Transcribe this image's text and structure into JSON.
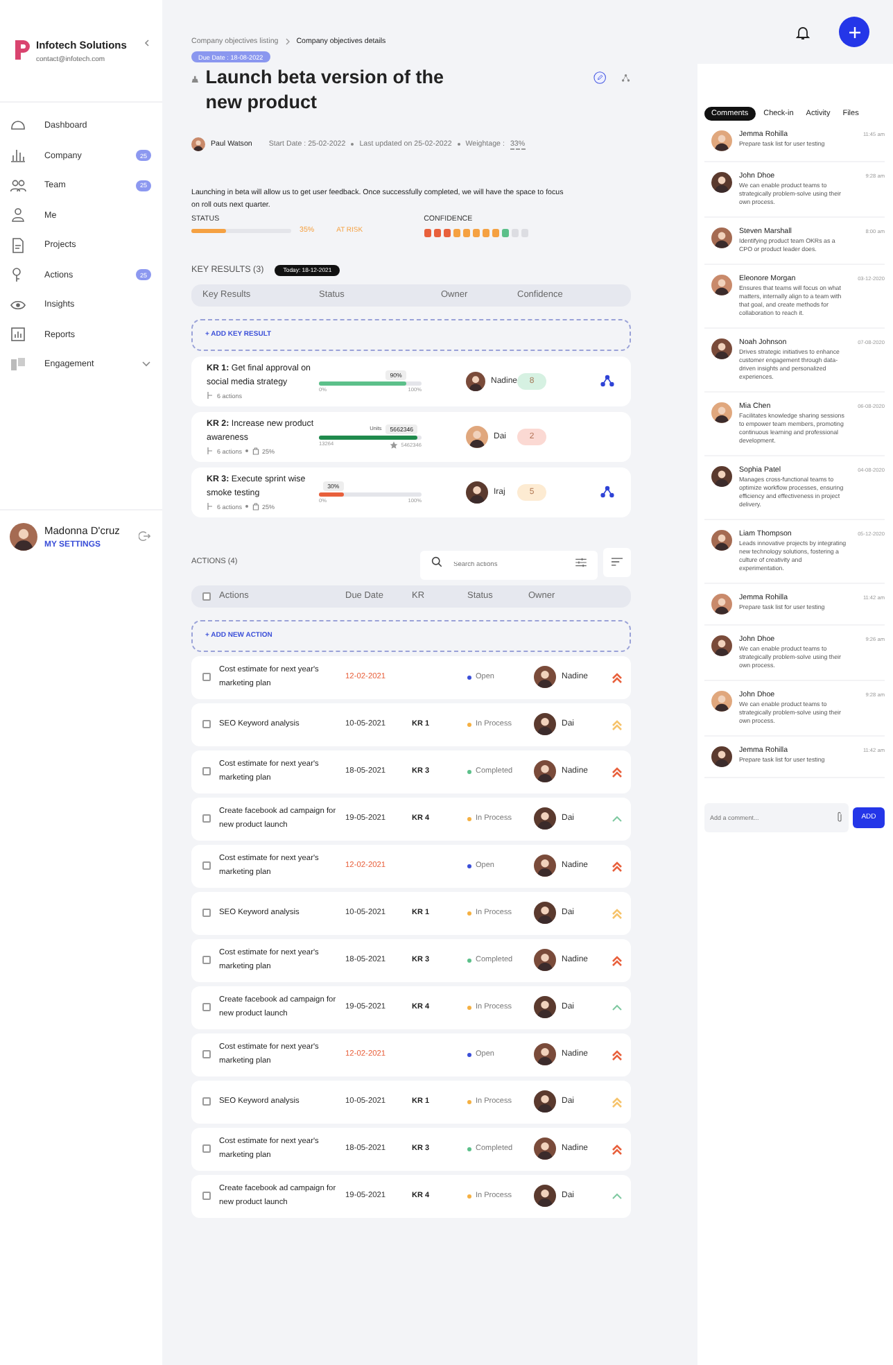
{
  "sidebar": {
    "company": "Infotech Solutions",
    "email": "contact@infotech.com",
    "items": [
      {
        "label": "Dashboard",
        "kind": "link"
      },
      {
        "label": "Company",
        "kind": "link",
        "badge": "25"
      },
      {
        "label": "Team",
        "kind": "link",
        "badge": "25"
      },
      {
        "label": "Me",
        "kind": "link"
      },
      {
        "label": "Projects",
        "kind": "link"
      },
      {
        "label": "Actions",
        "kind": "link",
        "badge": "25"
      },
      {
        "label": "Insights",
        "kind": "link"
      },
      {
        "label": "Reports",
        "kind": "link"
      },
      {
        "label": "Engagement",
        "kind": "group"
      }
    ],
    "user": {
      "name": "Madonna D'cruz",
      "link": "MY SETTINGS"
    }
  },
  "objective": {
    "breadcrumb": [
      "Company objectives listing",
      "Company objectives details"
    ],
    "due": "Due Date : 18-08-2022",
    "title": "Launch beta version of the new product",
    "owner": "Paul Watson",
    "start": "Start Date : 25-02-2022",
    "updated": "Last updated on 25-02-2022",
    "weightage_label": "Weightage :",
    "weightage": "33%",
    "description": "Launching in beta will allow us to get user feedback. Once successfully completed, we will have the space to focus on roll outs next quarter.",
    "status_label": "STATUS",
    "level": 0.35,
    "percent": "35%",
    "risk": "AT RISK",
    "confidence_label": "CONFIDENCE",
    "confidence": [
      {
        "color": "#e8603c"
      },
      {
        "color": "#e8603c"
      },
      {
        "color": "#e8603c"
      },
      {
        "color": "#f5a142"
      },
      {
        "color": "#f5a142"
      },
      {
        "color": "#f5a142"
      },
      {
        "color": "#f5a142"
      },
      {
        "color": "#f5a142"
      },
      {
        "color": "#5cc08a"
      },
      {
        "color": "#dcdde2"
      },
      {
        "color": "#dcdde2"
      }
    ]
  },
  "key_results": {
    "heading": "KEY RESULTS (3)",
    "today": "Today: 18-12-2021",
    "columns": [
      "Key Results",
      "Status",
      "Owner",
      "Confidence"
    ],
    "add": "+ ADD KEY RESULT",
    "items": [
      {
        "title": "**KR 1:** Get final approval on social media strategy",
        "actions": "6 actions",
        "progress": {
          "level": 0.85,
          "color": "#5cc08a"
        },
        "value": "90%",
        "min": "0%",
        "max": "100%",
        "owner": "Nadine",
        "confidence": {
          "value": "8",
          "color": "#d6f1e2"
        },
        "aligned": true
      },
      {
        "title": "**KR 2:** Increase new product awareness",
        "actions": "6 actions",
        "weight": "25%",
        "progress": {
          "level": 0.96,
          "color": "#1f8a4c"
        },
        "unit": "Units",
        "value": "5662346",
        "min": "13264",
        "max": "5462346",
        "owner": "Dai",
        "confidence": {
          "value": "2",
          "color": "#fbd9d3"
        },
        "aligned": false
      },
      {
        "title": "**KR 3:** Execute sprint wise smoke testing",
        "actions": "6 actions",
        "weight": "25%",
        "progress": {
          "level": 0.24,
          "color": "#e8603c"
        },
        "value": "30%",
        "min": "0%",
        "max": "100%",
        "owner": "Iraj",
        "confidence": {
          "value": "5",
          "color": "#fdebd2"
        },
        "aligned": true
      }
    ]
  },
  "actions": {
    "heading": "ACTIONS (4)",
    "search_placeholder": "Search actions",
    "columns": [
      "Actions",
      "Due Date",
      "KR",
      "Status",
      "Owner"
    ],
    "add": "+ ADD NEW ACTION",
    "all_checked": false,
    "rows": [
      {
        "kind": "high",
        "title": "Cost estimate for next year's marketing plan",
        "due": "12-02-2021",
        "overdue": true,
        "status": {
          "label": "Open",
          "color": "#3b4fd8"
        },
        "owner": "Nadine",
        "checked": false
      },
      {
        "kind": "medium",
        "title": "SEO Keyword analysis",
        "due": "10-05-2021",
        "overdue": false,
        "kr": "KR 1",
        "status": {
          "label": "In Process",
          "color": "#f5b042"
        },
        "owner": "Dai",
        "checked": false
      },
      {
        "kind": "high",
        "title": "Cost estimate for next year's marketing plan",
        "due": "18-05-2021",
        "overdue": false,
        "kr": "KR 3",
        "status": {
          "label": "Completed",
          "color": "#5cc08a"
        },
        "owner": "Nadine",
        "checked": false
      },
      {
        "kind": "low",
        "title": "Create facebook ad campaign for new product launch",
        "due": "19-05-2021",
        "overdue": false,
        "kr": "KR 4",
        "status": {
          "label": "In Process",
          "color": "#f5b042"
        },
        "owner": "Dai",
        "checked": false
      },
      {
        "kind": "high",
        "title": "Cost estimate for next year's marketing plan",
        "due": "12-02-2021",
        "overdue": true,
        "status": {
          "label": "Open",
          "color": "#3b4fd8"
        },
        "owner": "Nadine",
        "checked": false
      },
      {
        "kind": "medium",
        "title": "SEO Keyword analysis",
        "due": "10-05-2021",
        "overdue": false,
        "kr": "KR 1",
        "status": {
          "label": "In Process",
          "color": "#f5b042"
        },
        "owner": "Dai",
        "checked": false
      },
      {
        "kind": "high",
        "title": "Cost estimate for next year's marketing plan",
        "due": "18-05-2021",
        "overdue": false,
        "kr": "KR 3",
        "status": {
          "label": "Completed",
          "color": "#5cc08a"
        },
        "owner": "Nadine",
        "checked": false
      },
      {
        "kind": "low",
        "title": "Create facebook ad campaign for new product launch",
        "due": "19-05-2021",
        "overdue": false,
        "kr": "KR 4",
        "status": {
          "label": "In Process",
          "color": "#f5b042"
        },
        "owner": "Dai",
        "checked": false
      },
      {
        "kind": "high",
        "title": "Cost estimate for next year's marketing plan",
        "due": "12-02-2021",
        "overdue": true,
        "status": {
          "label": "Open",
          "color": "#3b4fd8"
        },
        "owner": "Nadine",
        "checked": false
      },
      {
        "kind": "medium",
        "title": "SEO Keyword analysis",
        "due": "10-05-2021",
        "overdue": false,
        "kr": "KR 1",
        "status": {
          "label": "In Process",
          "color": "#f5b042"
        },
        "owner": "Dai",
        "checked": false
      },
      {
        "kind": "high",
        "title": "Cost estimate for next year's marketing plan",
        "due": "18-05-2021",
        "overdue": false,
        "kr": "KR 3",
        "status": {
          "label": "Completed",
          "color": "#5cc08a"
        },
        "owner": "Nadine",
        "checked": false
      },
      {
        "kind": "low",
        "title": "Create facebook ad campaign for new product launch",
        "due": "19-05-2021",
        "overdue": false,
        "kr": "KR 4",
        "status": {
          "label": "In Process",
          "color": "#f5b042"
        },
        "owner": "Dai",
        "checked": false
      }
    ]
  },
  "panel": {
    "tabs": [
      {
        "label": "Comments",
        "selected": true
      },
      {
        "label": "Check-in",
        "selected": false
      },
      {
        "label": "Activity",
        "selected": false
      },
      {
        "label": "Files",
        "selected": false
      }
    ],
    "comments": [
      {
        "name": "Jemma Rohilla",
        "time": "11:45 am",
        "text": "Prepare task list for user testing"
      },
      {
        "name": "John Dhoe",
        "time": "9:28 am",
        "text": "We can enable product teams to strategically problem-solve using their own process."
      },
      {
        "name": "Steven Marshall",
        "time": "8:00 am",
        "text": "Identifying product team OKRs as a CPO or product leader does."
      },
      {
        "name": "Eleonore Morgan",
        "time": "03-12-2020",
        "text": "Ensures that teams will focus on what matters, internally align to a team with that goal, and create methods for collaboration to reach it."
      },
      {
        "name": "Noah Johnson",
        "time": "07-08-2020",
        "text": "Drives strategic initiatives to enhance customer engagement through data-driven insights and personalized experiences."
      },
      {
        "name": "Mia Chen",
        "time": "06-08-2020",
        "text": "Facilitates knowledge sharing sessions to empower team members, promoting continuous learning and professional development."
      },
      {
        "name": "Sophia Patel",
        "time": "04-08-2020",
        "text": "Manages cross-functional teams to optimize workflow processes, ensuring efficiency and effectiveness in project delivery."
      },
      {
        "name": "Liam Thompson",
        "time": "05-12-2020",
        "text": "Leads innovative projects by integrating new technology solutions, fostering a culture of creativity and experimentation."
      },
      {
        "name": "Jemma Rohilla",
        "time": "11:42 am",
        "text": "Prepare task list for user testing"
      },
      {
        "name": "John Dhoe",
        "time": "9:26 am",
        "text": "We can enable product teams to strategically problem-solve using their own process."
      },
      {
        "name": "John Dhoe",
        "time": "9:28 am",
        "text": "We can enable product teams to strategically problem-solve using their own process."
      },
      {
        "name": "Jemma Rohilla",
        "time": "11:42 am",
        "text": "Prepare task list for user testing"
      }
    ],
    "composer_placeholder": "Add a comment...",
    "add_button": "ADD"
  }
}
